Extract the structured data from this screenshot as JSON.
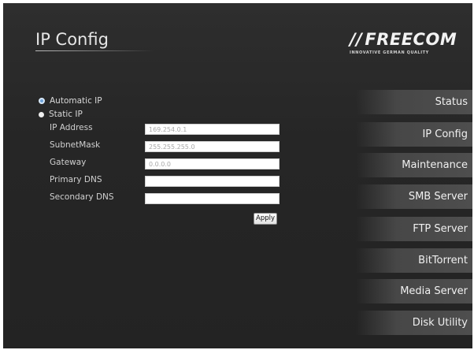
{
  "header": {
    "title": "IP Config",
    "logo": {
      "wordmark": "FREECOM",
      "tagline": "INNOVATIVE GERMAN QUALITY"
    }
  },
  "ip_mode": {
    "automatic_label": "Automatic IP",
    "static_label": "Static IP",
    "selected": "Automatic IP"
  },
  "fields": [
    {
      "label": "IP Address",
      "value": "169.254.0.1"
    },
    {
      "label": "SubnetMask",
      "value": "255.255.255.0"
    },
    {
      "label": "Gateway",
      "value": "0.0.0.0"
    },
    {
      "label": "Primary DNS",
      "value": ""
    },
    {
      "label": "Secondary DNS",
      "value": ""
    }
  ],
  "apply_label": "Apply",
  "nav": [
    {
      "label": "Status"
    },
    {
      "label": "IP Config"
    },
    {
      "label": "Maintenance"
    },
    {
      "label": "SMB Server"
    },
    {
      "label": "FTP Server"
    },
    {
      "label": "BitTorrent"
    },
    {
      "label": "Media Server"
    },
    {
      "label": "Disk Utility"
    }
  ]
}
